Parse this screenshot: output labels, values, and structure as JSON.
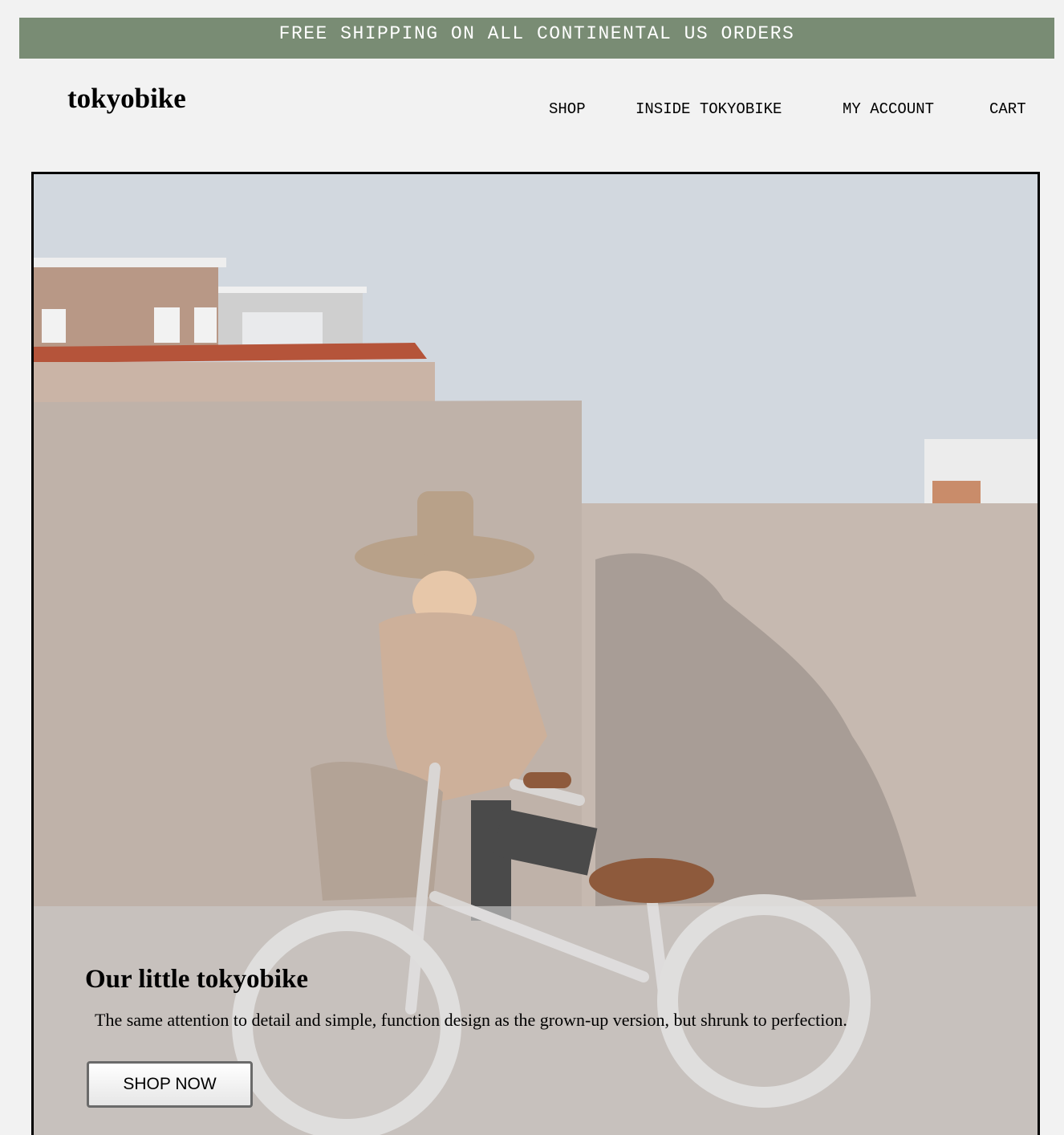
{
  "announcement": {
    "text": "FREE SHIPPING ON ALL CONTINENTAL US ORDERS"
  },
  "header": {
    "logo": "tokyobike"
  },
  "nav": {
    "items": [
      {
        "label": "SHOP"
      },
      {
        "label": "INSIDE TOKYOBIKE"
      },
      {
        "label": "MY ACCOUNT"
      },
      {
        "label": "CART"
      }
    ]
  },
  "hero": {
    "title": "Our little tokyobike",
    "description": "The same attention to detail and simple, function design as the grown-up version, but shrunk to perfection.",
    "cta_label": "SHOP NOW"
  }
}
